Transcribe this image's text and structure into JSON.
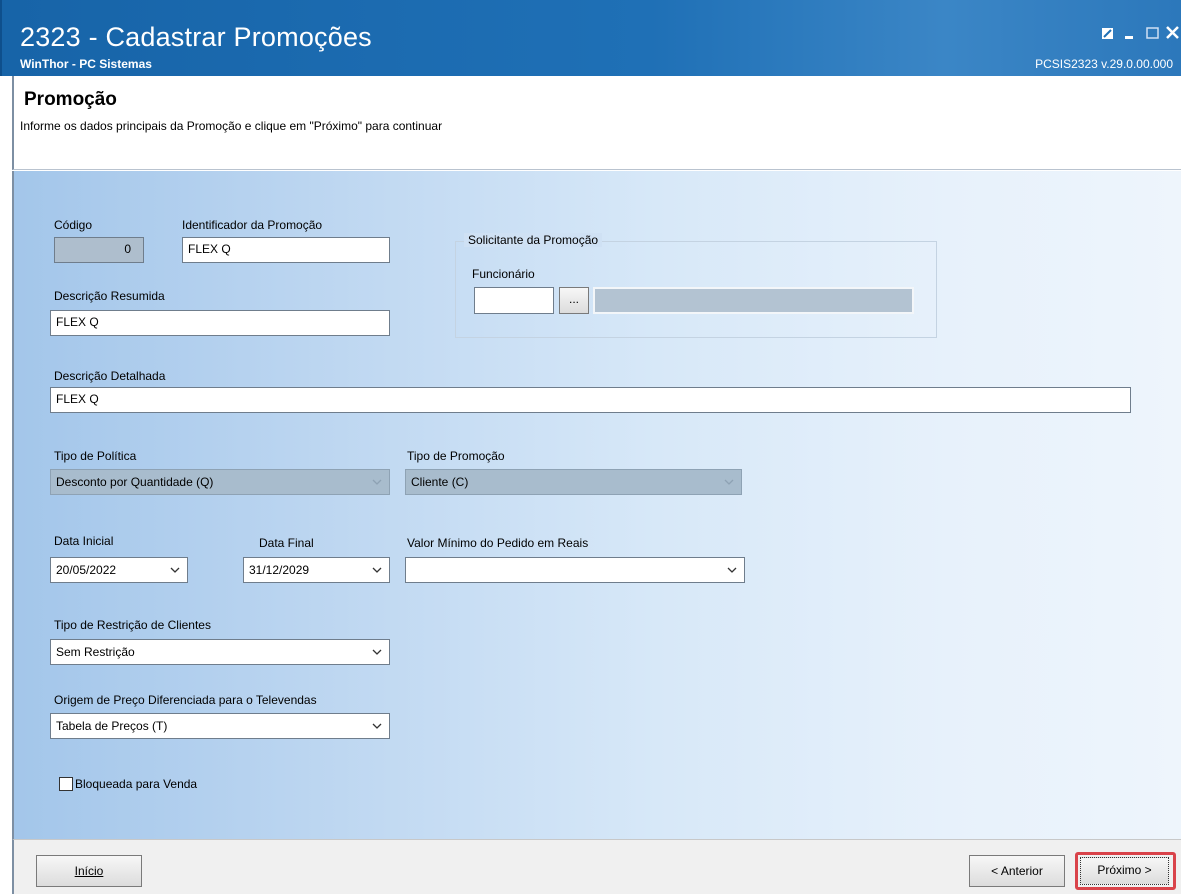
{
  "window": {
    "title": "2323 - Cadastrar Promoções",
    "subtitle": "WinThor - PC Sistemas",
    "version": "PCSIS2323  v.29.0.00.000"
  },
  "header": {
    "title": "Promoção",
    "description": "Informe os dados principais da Promoção e clique em \"Próximo\" para continuar"
  },
  "form": {
    "codigo": {
      "label": "Código",
      "value": "0"
    },
    "identificador": {
      "label": "Identificador da Promoção",
      "value": "FLEX Q"
    },
    "descricao_resumida": {
      "label": "Descrição Resumida",
      "value": "FLEX Q"
    },
    "solicitante": {
      "legend": "Solicitante da Promoção",
      "funcionario_label": "Funcionário",
      "funcionario_code": "",
      "lookup_button": "...",
      "funcionario_name": ""
    },
    "descricao_detalhada": {
      "label": "Descrição Detalhada",
      "value": "FLEX Q"
    },
    "tipo_politica": {
      "label": "Tipo de Política",
      "value": "Desconto por Quantidade (Q)"
    },
    "tipo_promocao": {
      "label": "Tipo de Promoção",
      "value": "Cliente (C)"
    },
    "data_inicial": {
      "label": "Data Inicial",
      "value": "20/05/2022"
    },
    "data_final": {
      "label": "Data Final",
      "value": "31/12/2029"
    },
    "valor_minimo": {
      "label": "Valor Mínimo do Pedido em Reais",
      "value": ""
    },
    "tipo_restricao": {
      "label": "Tipo de Restrição de Clientes",
      "value": "Sem Restrição"
    },
    "origem_preco": {
      "label": "Origem de Preço Diferenciada para o Televendas",
      "value": "Tabela de Preços (T)"
    },
    "bloqueada": {
      "label": "Bloqueada para Venda",
      "checked": false
    }
  },
  "footer": {
    "inicio_label": "Início",
    "anterior_label": "< Anterior",
    "proximo_label": "Próximo >"
  },
  "colors": {
    "titlebar": "#1f70b6",
    "highlight": "#d9434a"
  }
}
